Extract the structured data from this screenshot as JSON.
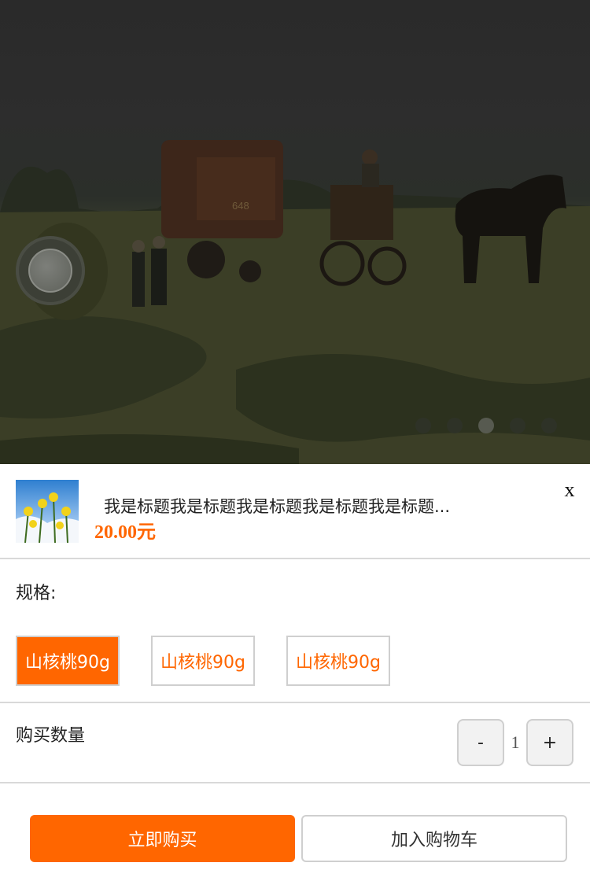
{
  "carousel": {
    "slide_count": 5,
    "active_index": 2
  },
  "product": {
    "title": "我是标题我是标题我是标题我是标题我是标题...",
    "price": "20.00元",
    "close_label": "x"
  },
  "spec": {
    "label": "规格:",
    "options": [
      "山核桃90g",
      "山核桃90g",
      "山核桃90g"
    ],
    "selected_index": 0
  },
  "quantity": {
    "label": "购买数量",
    "minus": "-",
    "value": "1",
    "plus": "+"
  },
  "actions": {
    "buy_now": "立即购买",
    "add_to_cart": "加入购物车"
  },
  "colors": {
    "accent": "#ff6600",
    "border": "#cfcfcf",
    "overlay": "#2a2a2a"
  }
}
